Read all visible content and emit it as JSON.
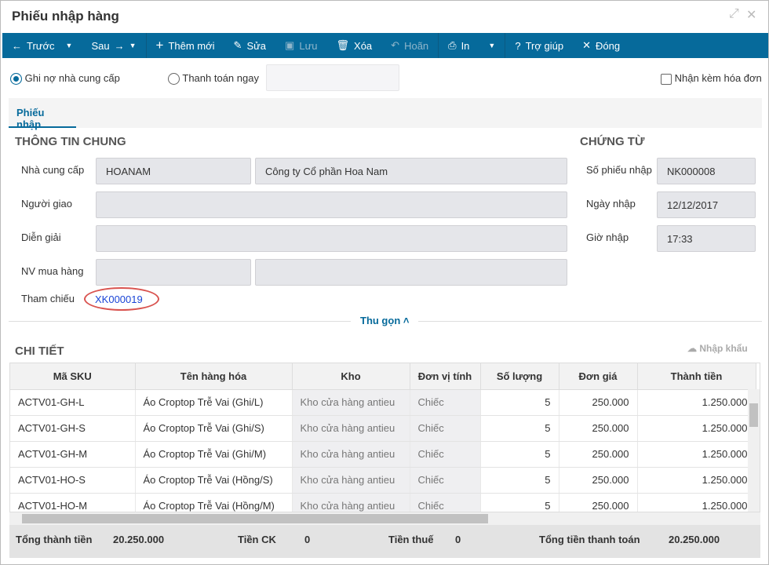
{
  "window": {
    "title": "Phiếu nhập hàng"
  },
  "toolbar": {
    "prev": "Trước",
    "next": "Sau",
    "add": "Thêm mới",
    "edit": "Sửa",
    "save": "Lưu",
    "delete": "Xóa",
    "undo": "Hoãn",
    "print": "In",
    "help": "Trợ giúp",
    "close": "Đóng"
  },
  "payment": {
    "debt": "Ghi nợ nhà cung cấp",
    "pay_now": "Thanh toán ngay",
    "invoice": "Nhận kèm hóa đơn"
  },
  "tabs": {
    "receipt": "Phiếu nhập"
  },
  "general": {
    "heading": "THÔNG TIN CHUNG",
    "supplier_label": "Nhà cung cấp",
    "supplier_code": "HOANAM",
    "supplier_name": "Công ty Cổ phần Hoa Nam",
    "deliverer_label": "Người giao",
    "note_label": "Diễn giải",
    "buyer_label": "NV mua hàng",
    "ref_label": "Tham chiếu",
    "ref_value": "XK000019",
    "collapse": "Thu gọn"
  },
  "voucher": {
    "heading": "CHỨNG TỪ",
    "no_label": "Số phiếu nhập",
    "no": "NK000008",
    "date_label": "Ngày nhập",
    "date": "12/12/2017",
    "time_label": "Giờ nhập",
    "time": "17:33"
  },
  "detail": {
    "heading": "CHI TIẾT",
    "import": "Nhập khẩu",
    "columns": [
      "Mã SKU",
      "Tên hàng hóa",
      "Kho",
      "Đơn vị tính",
      "Số lượng",
      "Đơn giá",
      "Thành tiền"
    ],
    "rows": [
      [
        "ACTV01-GH-L",
        "Áo Croptop Trễ Vai (Ghi/L)",
        "Kho cửa hàng antieu",
        "Chiếc",
        "5",
        "250.000",
        "1.250.000"
      ],
      [
        "ACTV01-GH-S",
        "Áo Croptop Trễ Vai (Ghi/S)",
        "Kho cửa hàng antieu",
        "Chiếc",
        "5",
        "250.000",
        "1.250.000"
      ],
      [
        "ACTV01-GH-M",
        "Áo Croptop Trễ Vai (Ghi/M)",
        "Kho cửa hàng antieu",
        "Chiếc",
        "5",
        "250.000",
        "1.250.000"
      ],
      [
        "ACTV01-HO-S",
        "Áo Croptop Trễ Vai (Hồng/S)",
        "Kho cửa hàng antieu",
        "Chiếc",
        "5",
        "250.000",
        "1.250.000"
      ],
      [
        "ACTV01-HO-M",
        "Áo Croptop Trễ Vai (Hồng/M)",
        "Kho cửa hàng antieu",
        "Chiếc",
        "5",
        "250.000",
        "1.250.000"
      ]
    ]
  },
  "totals": {
    "subtotal_label": "Tổng thành tiền",
    "subtotal": "20.250.000",
    "discount_label": "Tiền CK",
    "discount": "0",
    "tax_label": "Tiền thuế",
    "tax": "0",
    "total_label": "Tổng tiền thanh toán",
    "total": "20.250.000"
  }
}
